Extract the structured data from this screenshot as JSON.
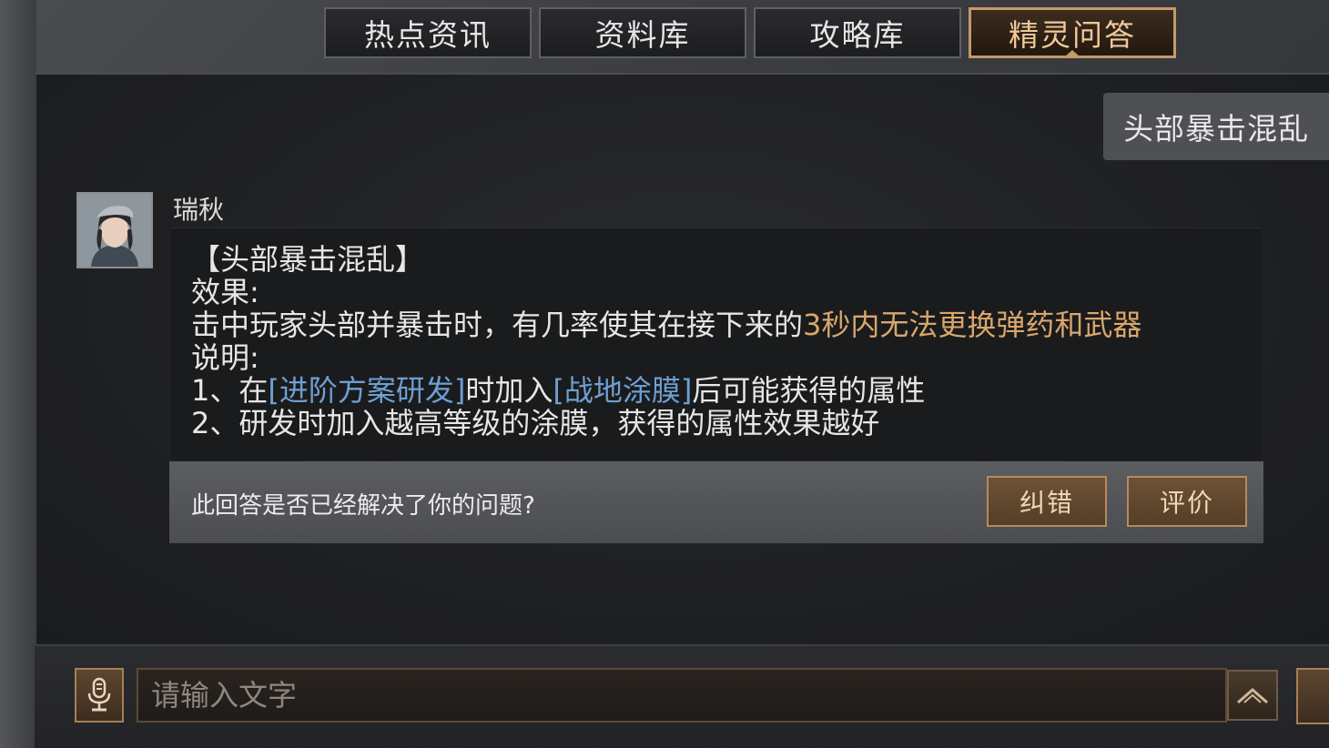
{
  "tabs": [
    {
      "label": "热点资讯",
      "active": false
    },
    {
      "label": "资料库",
      "active": false
    },
    {
      "label": "攻略库",
      "active": false
    },
    {
      "label": "精灵问答",
      "active": true
    }
  ],
  "chat": {
    "user_query": "头部暴击混乱",
    "bot_name": "瑞秋",
    "answer": {
      "title": "【头部暴击混乱】",
      "effect_label": "效果:",
      "effect_text_prefix": "击中玩家头部并暴击时，有几率使其在接下来的",
      "effect_text_highlight": "3秒内无法更换弹药和武器",
      "desc_label": "说明:",
      "desc1_prefix": "1、在",
      "desc1_link1": "[进阶方案研发]",
      "desc1_mid": "时加入",
      "desc1_link2": "[战地涂膜]",
      "desc1_suffix": "后可能获得的属性",
      "desc2": "2、研发时加入越高等级的涂膜，获得的属性效果越好"
    },
    "feedback": {
      "question": "此回答是否已经解决了你的问题?",
      "correct_label": "纠错",
      "rate_label": "评价"
    }
  },
  "input": {
    "placeholder": "请输入文字",
    "value": ""
  },
  "colors": {
    "accent": "#c49a68",
    "highlight": "#d9a66c",
    "link": "#6e9fd3"
  },
  "icons": [
    "microphone-icon",
    "send-arrow-icon"
  ]
}
